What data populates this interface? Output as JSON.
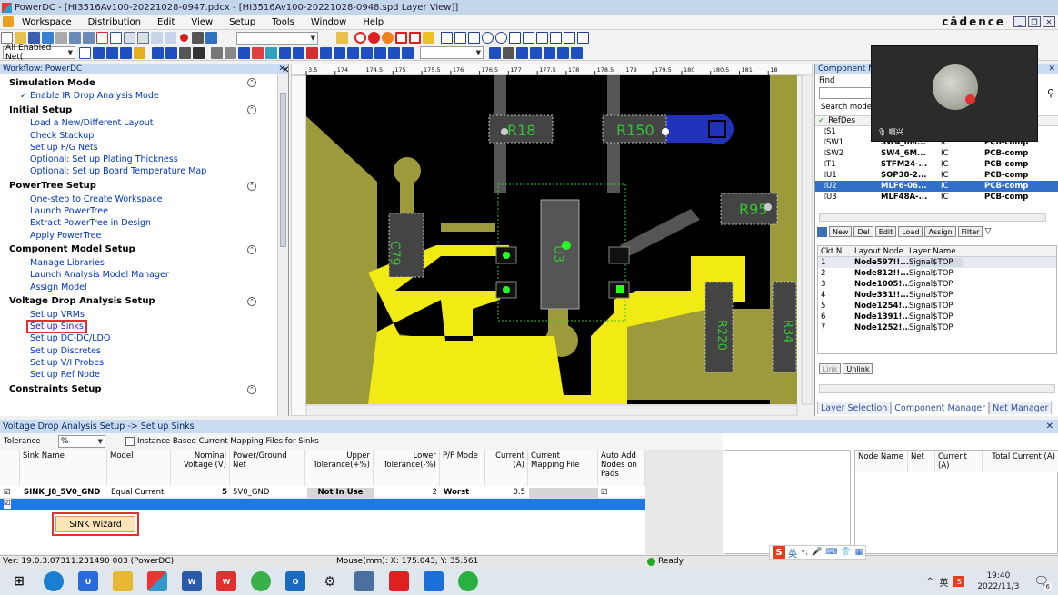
{
  "window": {
    "app_name": "PowerDC",
    "title": "PowerDC - [HI3516Av100-20221028-0947.pdcx - [HI3516Av100-20221028-0948.spd Layer View]]",
    "brand": "cādence"
  },
  "menu": [
    "Workspace",
    "Distribution",
    "Edit",
    "View",
    "Setup",
    "Tools",
    "Window",
    "Help"
  ],
  "toolbar": {
    "net_filter_label": "All Enabled Net(",
    "net_filter2": "",
    "layer_combo": ""
  },
  "ruler": [
    "3.5",
    "174",
    "174.5",
    "175",
    "175.5",
    "176",
    "176.5",
    "177",
    "177.5",
    "178",
    "178.5",
    "179",
    "179.5",
    "180",
    "180.5",
    "181",
    "18"
  ],
  "workflow": {
    "title": "Workflow: PowerDC",
    "sections": [
      {
        "title": "Simulation Mode",
        "items": [
          "Enable IR Drop Analysis Mode"
        ],
        "checked": true
      },
      {
        "title": "Initial Setup",
        "items": [
          "Load a New/Different Layout",
          "Check Stackup",
          "Set up P/G Nets",
          "Optional: Set up Plating Thickness",
          "Optional: Set up Board Temperature Map"
        ]
      },
      {
        "title": "PowerTree Setup",
        "items": [
          "One-step to Create Workspace",
          "Launch PowerTree",
          "Extract PowerTree in Design",
          "Apply PowerTree"
        ]
      },
      {
        "title": "Component Model Setup",
        "items": [
          "Manage Libraries",
          "Launch Analysis Model Manager",
          "Assign Model"
        ]
      },
      {
        "title": "Voltage Drop Analysis Setup",
        "items": [
          "Set up VRMs",
          "Set up Sinks",
          "Set up DC-DC/LDO",
          "Set up Discretes",
          "Set up V/I Probes",
          "Set up Ref Node"
        ]
      },
      {
        "title": "Constraints Setup",
        "items": []
      }
    ]
  },
  "pcb_labels": {
    "r18": "R18",
    "r150": "R150",
    "r95": "R95",
    "c79": "C79",
    "u": "U3",
    "r220": "R220",
    "r34": "R34"
  },
  "component_manager": {
    "title": "Component M",
    "find_label": "Find",
    "search_mode_label": "Search mode:",
    "col_refdes": "RefDes",
    "rows": [
      {
        "ref": "S1",
        "part": "",
        "type": "",
        "model": ""
      },
      {
        "ref": "SW1",
        "part": "SW4_6M...",
        "type": "IC",
        "model": "PCB-comp"
      },
      {
        "ref": "SW2",
        "part": "SW4_6M...",
        "type": "IC",
        "model": "PCB-comp"
      },
      {
        "ref": "T1",
        "part": "STFM24-...",
        "type": "IC",
        "model": "PCB-comp"
      },
      {
        "ref": "U1",
        "part": "SOP38-2...",
        "type": "IC",
        "model": "PCB-comp"
      },
      {
        "ref": "U2",
        "part": "MLF6-06...",
        "type": "IC",
        "model": "PCB-comp"
      },
      {
        "ref": "U3",
        "part": "MLF48A-...",
        "type": "IC",
        "model": "PCB-comp"
      }
    ],
    "buttons": [
      "New",
      "Del",
      "Edit",
      "Load",
      "Assign",
      "Filter"
    ],
    "ckt_header": [
      "Ckt N...",
      "Layout Node",
      "Layer Name"
    ],
    "ckt_rows": [
      [
        "1",
        "Node597!!...",
        "Signal$TOP"
      ],
      [
        "2",
        "Node812!!...",
        "Signal$TOP"
      ],
      [
        "3",
        "Node1005!...",
        "Signal$TOP"
      ],
      [
        "4",
        "Node331!!...",
        "Signal$TOP"
      ],
      [
        "5",
        "Node1254!...",
        "Signal$TOP"
      ],
      [
        "6",
        "Node1391!...",
        "Signal$TOP"
      ],
      [
        "7",
        "Node1252!...",
        "Signal$TOP"
      ]
    ],
    "link_buttons": [
      "Link",
      "Unlink"
    ],
    "tabs": [
      "Layer Selection",
      "Component Manager",
      "Net Manager"
    ]
  },
  "video_overlay": {
    "name": "啊兴"
  },
  "sinks_panel": {
    "title": "Voltage Drop Analysis Setup -> Set up Sinks",
    "tolerance_label": "Tolerance",
    "tolerance_unit": "%",
    "instance_checkbox_label": "Instance Based Current Mapping Files for Sinks",
    "columns": [
      "Sink Name",
      "Model",
      "Nominal Voltage (V)",
      "Power/Ground Net",
      "Upper Tolerance(+%)",
      "Lower Tolerance(-%)",
      "P/F Mode",
      "Current (A)",
      "Current Mapping File",
      "Auto Add Nodes on Pads"
    ],
    "row": {
      "name": "SINK_J8_5V0_GND",
      "model": "Equal Current",
      "voltage": "5",
      "net": "5V0_GND",
      "upper": "Not In Use",
      "lower": "2",
      "pf": "Worst",
      "current": "0.5"
    },
    "wizard_label": "SINK Wizard",
    "node_columns": [
      "Node Name",
      "Net",
      "Current (A)",
      "Total Current (A)"
    ]
  },
  "status": {
    "version": "Ver: 19.0.3.07311.231490  003 (PowerDC)",
    "mouse": "Mouse(mm): X: 175.043, Y: 35.561",
    "ready": "Ready"
  },
  "ime": {
    "lang": "英"
  },
  "taskbar": {
    "ime": "英",
    "time": "19:40",
    "date": "2022/11/3",
    "notif": "6"
  }
}
